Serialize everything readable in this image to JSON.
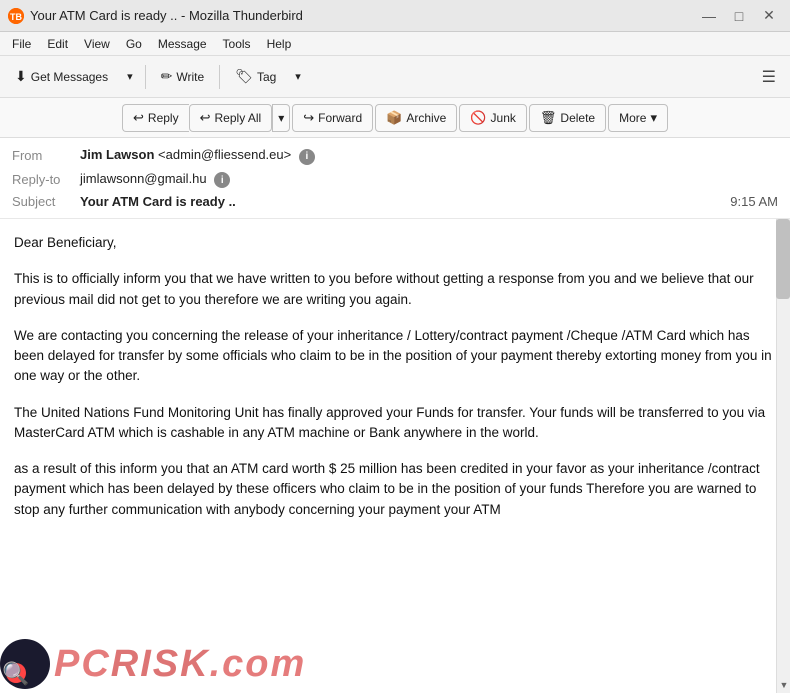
{
  "titleBar": {
    "icon": "TB",
    "title": "Your ATM Card is ready .. - Mozilla Thunderbird",
    "minimize": "—",
    "maximize": "□",
    "close": "✕"
  },
  "menuBar": {
    "items": [
      "File",
      "Edit",
      "View",
      "Go",
      "Message",
      "Tools",
      "Help"
    ]
  },
  "toolbar": {
    "getMessages": "Get Messages",
    "write": "Write",
    "tag": "Tag",
    "hamburger": "☰"
  },
  "actionBar": {
    "reply": "Reply",
    "replyAll": "Reply All",
    "forward": "Forward",
    "archive": "Archive",
    "junk": "Junk",
    "delete": "Delete",
    "more": "More"
  },
  "email": {
    "fromLabel": "From",
    "fromName": "Jim Lawson",
    "fromEmail": "<admin@fliessend.eu>",
    "replyToLabel": "Reply-to",
    "replyToEmail": "jimlawsonn@gmail.hu",
    "subjectLabel": "Subject",
    "subject": "Your ATM Card is ready ..",
    "time": "9:15 AM",
    "body": {
      "p1": "Dear Beneficiary,",
      "p2": "This is to officially inform you that we have written to you before without getting a response from you and we believe that our previous mail did not get to you therefore we are writing you again.",
      "p3": "We are contacting you concerning the release of your inheritance / Lottery/contract payment /Cheque /ATM Card which has been delayed for transfer by some officials who claim to be in the position of your payment thereby extorting money from you in one way or the other.",
      "p4": "The United Nations  Fund Monitoring Unit has finally approved your Funds for transfer. Your funds will be transferred to you via MasterCard ATM which is cashable in any ATM machine or Bank anywhere in the world.",
      "p5": "as a result of this inform you that an ATM card worth $ 25 million has been credited in your favor as your inheritance /contract payment which has been delayed by these officers who claim to be in the position of your funds Therefore you are warned to stop any further communication with anybody concerning your payment your ATM"
    }
  },
  "watermark": {
    "text": "PC",
    "textAccent": "RISK",
    "suffix": ".com"
  }
}
